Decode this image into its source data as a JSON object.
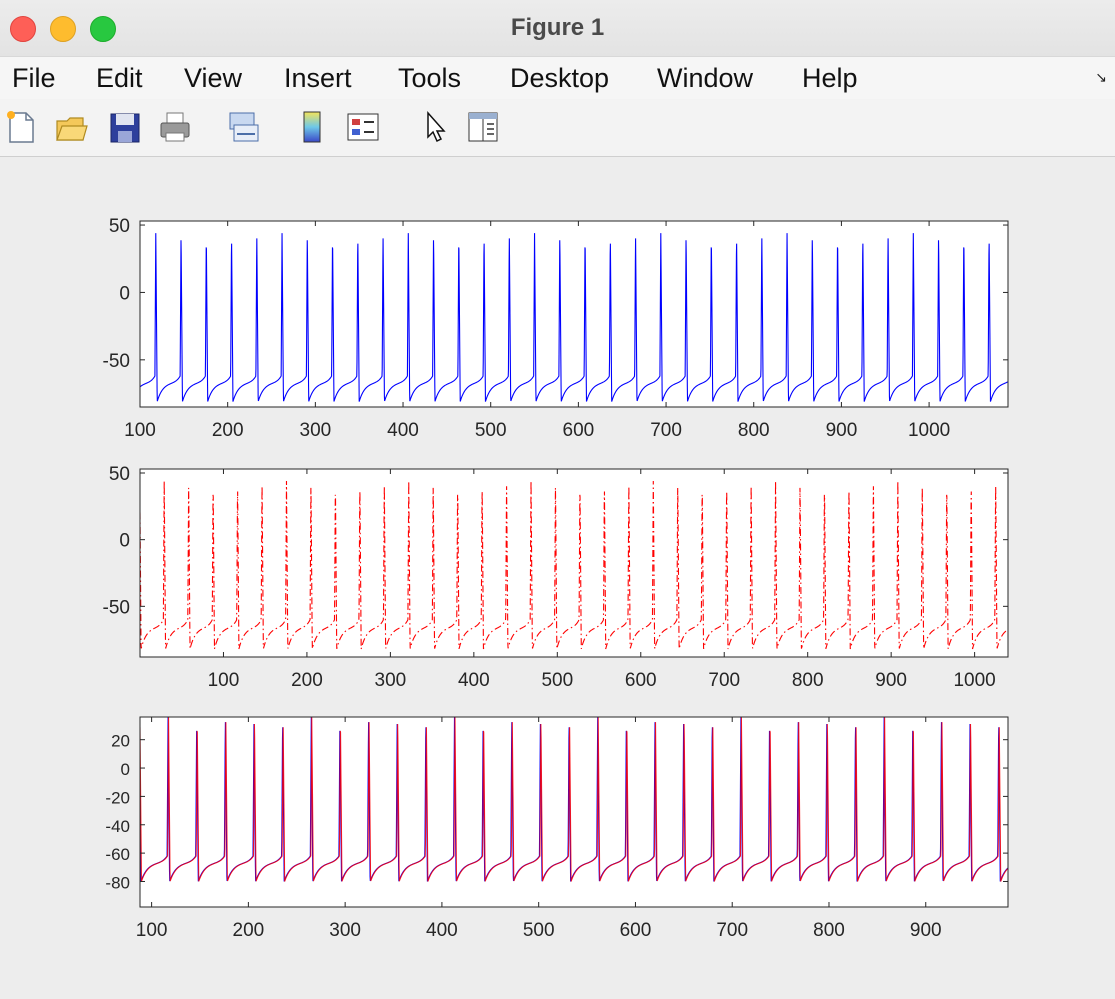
{
  "window": {
    "title": "Figure 1"
  },
  "menu": [
    "File",
    "Edit",
    "View",
    "Insert",
    "Tools",
    "Desktop",
    "Window",
    "Help"
  ],
  "toolbar": [
    "new-figure-icon",
    "open-file-icon",
    "save-icon",
    "print-icon",
    "link-plot-icon",
    "colorbar-icon",
    "legend-icon",
    "edit-plot-cursor-icon",
    "property-inspector-icon"
  ],
  "chart_data": [
    {
      "type": "line",
      "xlim": [
        100,
        1090
      ],
      "ylim": [
        -85,
        53
      ],
      "xticks": [
        100,
        200,
        300,
        400,
        500,
        600,
        700,
        800,
        900,
        1000
      ],
      "yticks": [
        50,
        0,
        -50
      ],
      "series": [
        {
          "color": "#0000ff",
          "style": "solid",
          "period": 28.8,
          "first_spike": 117,
          "peak": 44,
          "trough": -81,
          "baseline": -62
        }
      ],
      "grid": false
    },
    {
      "type": "line",
      "xlim": [
        0,
        1040
      ],
      "ylim": [
        -88,
        53
      ],
      "xticks": [
        100,
        200,
        300,
        400,
        500,
        600,
        700,
        800,
        900,
        1000
      ],
      "yticks": [
        50,
        0,
        -50
      ],
      "series": [
        {
          "color": "#ff0000",
          "style": "dash-dot",
          "period": 29.3,
          "first_spike": 28,
          "peak": 44,
          "trough": -82,
          "baseline": -60
        }
      ],
      "grid": false
    },
    {
      "type": "line",
      "xlim": [
        88,
        985
      ],
      "ylim": [
        -98,
        36
      ],
      "xticks": [
        100,
        200,
        300,
        400,
        500,
        600,
        700,
        800,
        900
      ],
      "yticks": [
        20,
        0,
        -20,
        -40,
        -60,
        -80
      ],
      "series": [
        {
          "color": "#0000ff",
          "style": "solid",
          "period": 29.6,
          "first_spike": 116,
          "peak": 36,
          "trough": -80,
          "baseline": -62
        },
        {
          "color": "#ff0000",
          "style": "solid",
          "period": 29.6,
          "first_spike": 116.5,
          "peak": 36,
          "trough": -80,
          "baseline": -62
        }
      ],
      "grid": false
    }
  ]
}
